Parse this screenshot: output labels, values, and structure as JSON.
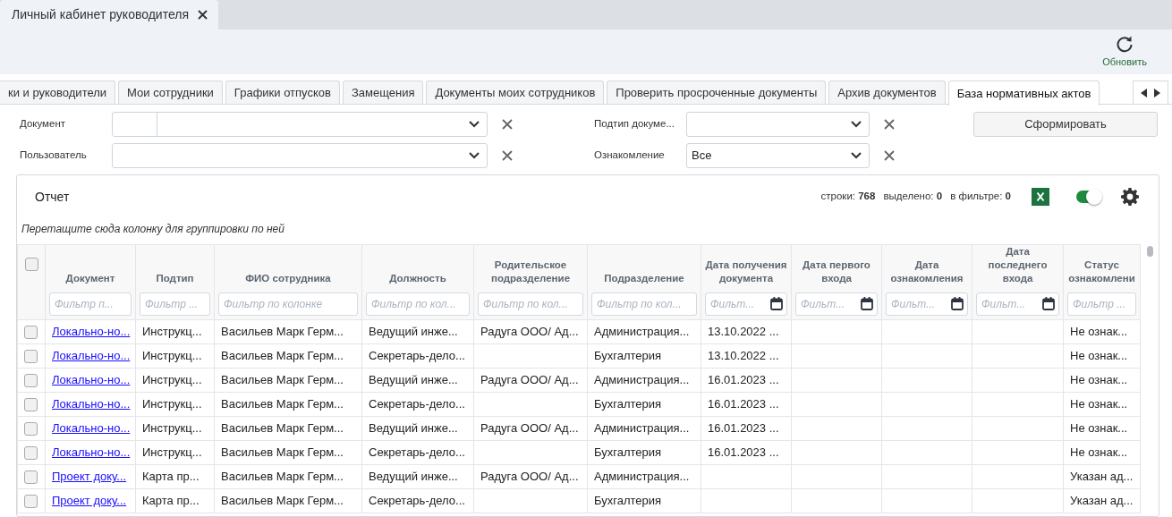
{
  "window_tab": {
    "title": "Личный кабинет руководителя"
  },
  "toolbar": {
    "refresh_label": "Обновить"
  },
  "tabs": [
    {
      "label": "ки и руководители",
      "selected": false
    },
    {
      "label": "Мои сотрудники",
      "selected": false
    },
    {
      "label": "Графики отпусков",
      "selected": false
    },
    {
      "label": "Замещения",
      "selected": false
    },
    {
      "label": "Документы моих сотрудников",
      "selected": false
    },
    {
      "label": "Проверить просроченные документы",
      "selected": false
    },
    {
      "label": "Архив документов",
      "selected": false
    },
    {
      "label": "База нормативных актов",
      "selected": true
    }
  ],
  "filters": [
    {
      "label": "Документ",
      "kind": "split"
    },
    {
      "label": "Подтип докуме...",
      "kind": "combo"
    },
    {
      "label": "Пользователь",
      "kind": "combo"
    },
    {
      "label": "Ознакомление",
      "kind": "combo",
      "value": "Все"
    }
  ],
  "generate_button": "Сформировать",
  "report": {
    "title": "Отчет",
    "stats": [
      "строки: **768**",
      "выделено: **0**",
      "в фильтре: **0**"
    ],
    "toggle_on": true,
    "group_hint": "Перетащите сюда колонку для группировки по ней",
    "select_all_checked": false,
    "columns": [
      {
        "title": "Документ",
        "placeholder": "Фильтр п...",
        "kind": "text"
      },
      {
        "title": "Подтип",
        "placeholder": "Фильтр ...",
        "kind": "text"
      },
      {
        "title": "ФИО сотрудника",
        "placeholder": "Фильтр по колонке",
        "kind": "text"
      },
      {
        "title": "Должность",
        "placeholder": "Фильтр по кол...",
        "kind": "text"
      },
      {
        "title": "Родительское подразделение",
        "placeholder": "Фильтр по кол...",
        "kind": "text"
      },
      {
        "title": "Подразделение",
        "placeholder": "Фильтр по кол...",
        "kind": "text"
      },
      {
        "title": "Дата получения документа",
        "placeholder": "Фильт...",
        "kind": "date"
      },
      {
        "title": "Дата первого входа",
        "placeholder": "Фильт...",
        "kind": "date"
      },
      {
        "title": "Дата ознакомления",
        "placeholder": "Фильт...",
        "kind": "date"
      },
      {
        "title": "Дата последнего входа",
        "placeholder": "Фильт...",
        "kind": "date"
      },
      {
        "title": "Статус ознакомлени",
        "placeholder": "Фильтр ...",
        "kind": "text"
      }
    ],
    "rows": [
      {
        "selected": false,
        "cells": [
          "Локально-но...",
          "Инструкц...",
          "Васильев Марк Герм...",
          "Ведущий инже...",
          "Радуга ООО/ Ад...",
          "Администрация...",
          "13.10.2022 ...",
          null,
          null,
          null,
          "Не ознак..."
        ]
      },
      {
        "selected": false,
        "cells": [
          "Локально-но...",
          "Инструкц...",
          "Васильев Марк Герм...",
          "Секретарь-дело...",
          null,
          "Бухгалтерия",
          "13.10.2022 ...",
          null,
          null,
          null,
          "Не ознак..."
        ]
      },
      {
        "selected": false,
        "cells": [
          "Локально-но...",
          "Инструкц...",
          "Васильев Марк Герм...",
          "Ведущий инже...",
          "Радуга ООО/ Ад...",
          "Администрация...",
          "16.01.2023 ...",
          null,
          null,
          null,
          "Не ознак..."
        ]
      },
      {
        "selected": false,
        "cells": [
          "Локально-но...",
          "Инструкц...",
          "Васильев Марк Герм...",
          "Секретарь-дело...",
          null,
          "Бухгалтерия",
          "16.01.2023 ...",
          null,
          null,
          null,
          "Не ознак..."
        ]
      },
      {
        "selected": false,
        "cells": [
          "Локально-но...",
          "Инструкц...",
          "Васильев Марк Герм...",
          "Ведущий инже...",
          "Радуга ООО/ Ад...",
          "Администрация...",
          "16.01.2023 ...",
          null,
          null,
          null,
          "Не ознак..."
        ]
      },
      {
        "selected": false,
        "cells": [
          "Локально-но...",
          "Инструкц...",
          "Васильев Марк Герм...",
          "Секретарь-дело...",
          null,
          "Бухгалтерия",
          "16.01.2023 ...",
          null,
          null,
          null,
          "Не ознак..."
        ]
      },
      {
        "selected": false,
        "cells": [
          "Проект доку...",
          "Карта пр...",
          "Васильев Марк Герм...",
          "Ведущий инже...",
          "Радуга ООО/ Ад...",
          "Администрация...",
          null,
          null,
          null,
          null,
          "Указан ад..."
        ]
      },
      {
        "selected": false,
        "cells": [
          "Проект доку...",
          "Карта пр...",
          "Васильев Марк Герм...",
          "Секретарь-дело...",
          null,
          "Бухгалтерия",
          null,
          null,
          null,
          null,
          "Указан ад..."
        ]
      }
    ]
  }
}
